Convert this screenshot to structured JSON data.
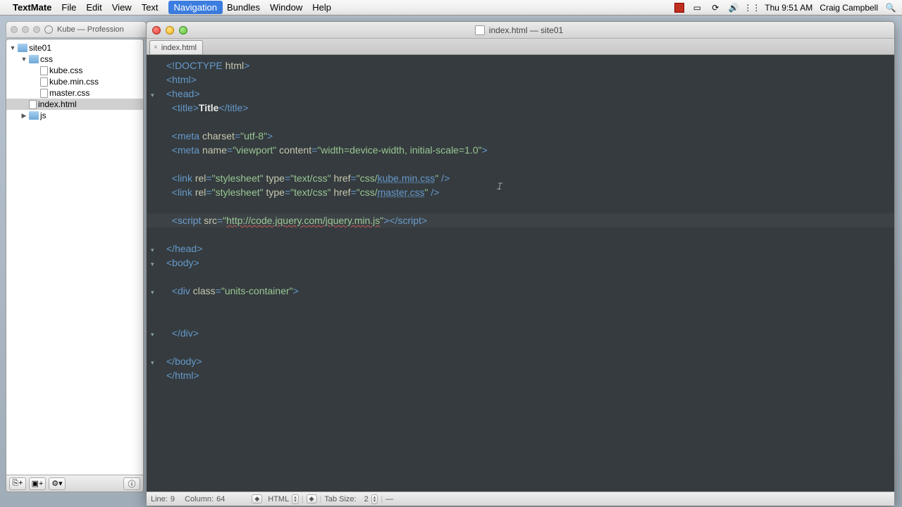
{
  "menubar": {
    "app": "TextMate",
    "items": [
      "File",
      "Edit",
      "View",
      "Text",
      "Navigation",
      "Bundles",
      "Window",
      "Help"
    ],
    "selected_index": 4,
    "clock": "Thu 9:51 AM",
    "user": "Craig Campbell"
  },
  "bgwindow": {
    "title": "Kube — Profession"
  },
  "tree": {
    "root": "site01",
    "nodes": [
      {
        "label": "site01",
        "type": "folder",
        "open": true,
        "indent": 0
      },
      {
        "label": "css",
        "type": "folder",
        "open": true,
        "indent": 1
      },
      {
        "label": "kube.css",
        "type": "file",
        "indent": 2
      },
      {
        "label": "kube.min.css",
        "type": "file",
        "indent": 2
      },
      {
        "label": "master.css",
        "type": "file",
        "indent": 2
      },
      {
        "label": "index.html",
        "type": "file",
        "indent": 1,
        "selected": true
      },
      {
        "label": "js",
        "type": "folder",
        "open": false,
        "indent": 1
      }
    ]
  },
  "editor": {
    "window_title": "index.html — site01",
    "tab": "index.html",
    "status": {
      "line_label": "Line:",
      "line": "9",
      "col_label": "Column:",
      "col": "64",
      "lang": "HTML",
      "tab_label": "Tab Size:",
      "tab_size": "2",
      "symbol": "—"
    },
    "code_lines": [
      {
        "tokens": [
          {
            "c": "t-tag",
            "t": "<!DOCTYPE "
          },
          {
            "c": "t-attr",
            "t": "html"
          },
          {
            "c": "t-tag",
            "t": ">"
          }
        ]
      },
      {
        "tokens": [
          {
            "c": "t-tag",
            "t": "<html>"
          }
        ]
      },
      {
        "tokens": [
          {
            "c": "t-tag",
            "t": "<head>"
          }
        ],
        "fold": true
      },
      {
        "tokens": [
          {
            "c": "",
            "t": "  "
          },
          {
            "c": "t-tag",
            "t": "<title>"
          },
          {
            "c": "t-txt",
            "t": "Title"
          },
          {
            "c": "t-tag",
            "t": "</title>"
          }
        ]
      },
      {
        "tokens": [
          {
            "c": "",
            "t": ""
          }
        ]
      },
      {
        "tokens": [
          {
            "c": "",
            "t": "  "
          },
          {
            "c": "t-tag",
            "t": "<meta "
          },
          {
            "c": "t-attr",
            "t": "charset"
          },
          {
            "c": "t-tag",
            "t": "="
          },
          {
            "c": "t-str",
            "t": "\"utf-8\""
          },
          {
            "c": "t-tag",
            "t": ">"
          }
        ]
      },
      {
        "tokens": [
          {
            "c": "",
            "t": "  "
          },
          {
            "c": "t-tag",
            "t": "<meta "
          },
          {
            "c": "t-attr",
            "t": "name"
          },
          {
            "c": "t-tag",
            "t": "="
          },
          {
            "c": "t-str",
            "t": "\"viewport\""
          },
          {
            "c": "",
            "t": " "
          },
          {
            "c": "t-attr",
            "t": "content"
          },
          {
            "c": "t-tag",
            "t": "="
          },
          {
            "c": "t-str",
            "t": "\"width=device-width, initial-scale=1.0\""
          },
          {
            "c": "t-tag",
            "t": ">"
          }
        ]
      },
      {
        "tokens": [
          {
            "c": "",
            "t": ""
          }
        ]
      },
      {
        "tokens": [
          {
            "c": "",
            "t": "  "
          },
          {
            "c": "t-tag",
            "t": "<link "
          },
          {
            "c": "t-attr",
            "t": "rel"
          },
          {
            "c": "t-tag",
            "t": "="
          },
          {
            "c": "t-str",
            "t": "\"stylesheet\""
          },
          {
            "c": "",
            "t": " "
          },
          {
            "c": "t-attr",
            "t": "type"
          },
          {
            "c": "t-tag",
            "t": "="
          },
          {
            "c": "t-str",
            "t": "\"text/css\""
          },
          {
            "c": "",
            "t": " "
          },
          {
            "c": "t-attr",
            "t": "href"
          },
          {
            "c": "t-tag",
            "t": "="
          },
          {
            "c": "t-str",
            "t": "\"css/"
          },
          {
            "c": "t-link",
            "t": "kube.min.css"
          },
          {
            "c": "t-str",
            "t": "\""
          },
          {
            "c": "t-tag",
            "t": " />"
          }
        ]
      },
      {
        "tokens": [
          {
            "c": "",
            "t": "  "
          },
          {
            "c": "t-tag",
            "t": "<link "
          },
          {
            "c": "t-attr",
            "t": "rel"
          },
          {
            "c": "t-tag",
            "t": "="
          },
          {
            "c": "t-str",
            "t": "\"stylesheet\""
          },
          {
            "c": "",
            "t": " "
          },
          {
            "c": "t-attr",
            "t": "type"
          },
          {
            "c": "t-tag",
            "t": "="
          },
          {
            "c": "t-str",
            "t": "\"text/css\""
          },
          {
            "c": "",
            "t": " "
          },
          {
            "c": "t-attr",
            "t": "href"
          },
          {
            "c": "t-tag",
            "t": "="
          },
          {
            "c": "t-str",
            "t": "\"css/"
          },
          {
            "c": "t-link",
            "t": "master.css"
          },
          {
            "c": "t-str",
            "t": "\""
          },
          {
            "c": "t-tag",
            "t": " />"
          }
        ]
      },
      {
        "tokens": [
          {
            "c": "",
            "t": ""
          }
        ]
      },
      {
        "tokens": [
          {
            "c": "",
            "t": "  "
          },
          {
            "c": "t-tag",
            "t": "<script "
          },
          {
            "c": "t-attr",
            "t": "src"
          },
          {
            "c": "t-tag",
            "t": "="
          },
          {
            "c": "t-str",
            "t": "\""
          },
          {
            "c": "t-url",
            "t": "http://code.jquery.com/jquery.min.js"
          },
          {
            "c": "t-str",
            "t": "\""
          },
          {
            "c": "t-tag",
            "t": "></"
          },
          {
            "c": "t-tag",
            "t": "script>"
          }
        ],
        "hl": true
      },
      {
        "tokens": [
          {
            "c": "",
            "t": ""
          }
        ]
      },
      {
        "tokens": [
          {
            "c": "t-tag",
            "t": "</head>"
          }
        ],
        "fold": true
      },
      {
        "tokens": [
          {
            "c": "t-tag",
            "t": "<body>"
          }
        ],
        "fold": true
      },
      {
        "tokens": [
          {
            "c": "",
            "t": ""
          }
        ]
      },
      {
        "tokens": [
          {
            "c": "",
            "t": "  "
          },
          {
            "c": "t-tag",
            "t": "<div "
          },
          {
            "c": "t-attr",
            "t": "class"
          },
          {
            "c": "t-tag",
            "t": "="
          },
          {
            "c": "t-str",
            "t": "\"units-container\""
          },
          {
            "c": "t-tag",
            "t": ">"
          }
        ],
        "fold": true
      },
      {
        "tokens": [
          {
            "c": "",
            "t": ""
          }
        ]
      },
      {
        "tokens": [
          {
            "c": "",
            "t": ""
          }
        ]
      },
      {
        "tokens": [
          {
            "c": "",
            "t": "  "
          },
          {
            "c": "t-tag",
            "t": "</div>"
          }
        ],
        "fold": true
      },
      {
        "tokens": [
          {
            "c": "",
            "t": ""
          }
        ]
      },
      {
        "tokens": [
          {
            "c": "t-tag",
            "t": "</body>"
          }
        ],
        "fold": true
      },
      {
        "tokens": [
          {
            "c": "t-tag",
            "t": "</html>"
          }
        ]
      }
    ]
  }
}
